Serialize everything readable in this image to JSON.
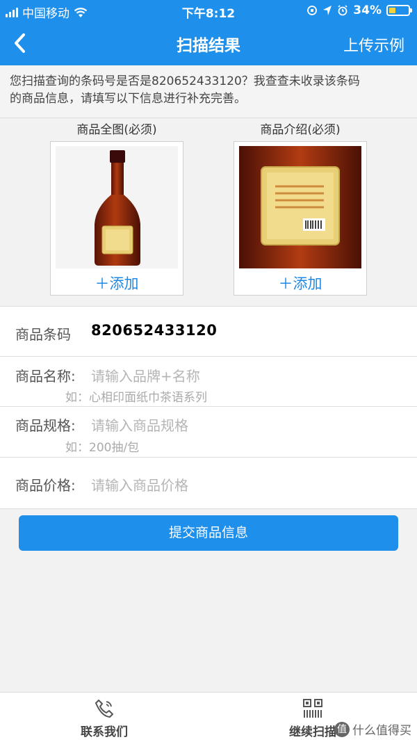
{
  "status_bar": {
    "carrier": "中国移动",
    "time": "下午8:12",
    "battery": "34%",
    "battery_level": 0.34
  },
  "nav": {
    "title": "扫描结果",
    "right_label": "上传示例",
    "back_icon": "chevron-left-icon"
  },
  "notice": {
    "line1": "您扫描查询的条码号是否是820652433120？我查查未收录该条码",
    "line2": "的商品信息，请填写以下信息进行补充完善。"
  },
  "photos": [
    {
      "label": "商品全图(必须)",
      "add_label": "＋添加"
    },
    {
      "label": "商品介绍(必须)",
      "add_label": "＋添加"
    }
  ],
  "form": {
    "barcode": {
      "label": "商品条码",
      "value": "820652433120"
    },
    "name": {
      "label": "商品名称:",
      "placeholder": "请输入品牌+名称",
      "hint": "如：心相印面纸巾茶语系列"
    },
    "spec": {
      "label": "商品规格:",
      "placeholder": "请输入商品规格",
      "hint": "如：200抽/包"
    },
    "price": {
      "label": "商品价格:",
      "placeholder": "请输入商品价格"
    }
  },
  "submit_label": "提交商品信息",
  "tabbar": {
    "contact": {
      "label": "联系我们",
      "icon": "phone-icon"
    },
    "scan": {
      "label": "继续扫描",
      "icon": "qr-scan-icon"
    }
  },
  "watermark": "什么值得买",
  "colors": {
    "accent": "#1e90ec",
    "add_blue": "#1e88e5"
  }
}
